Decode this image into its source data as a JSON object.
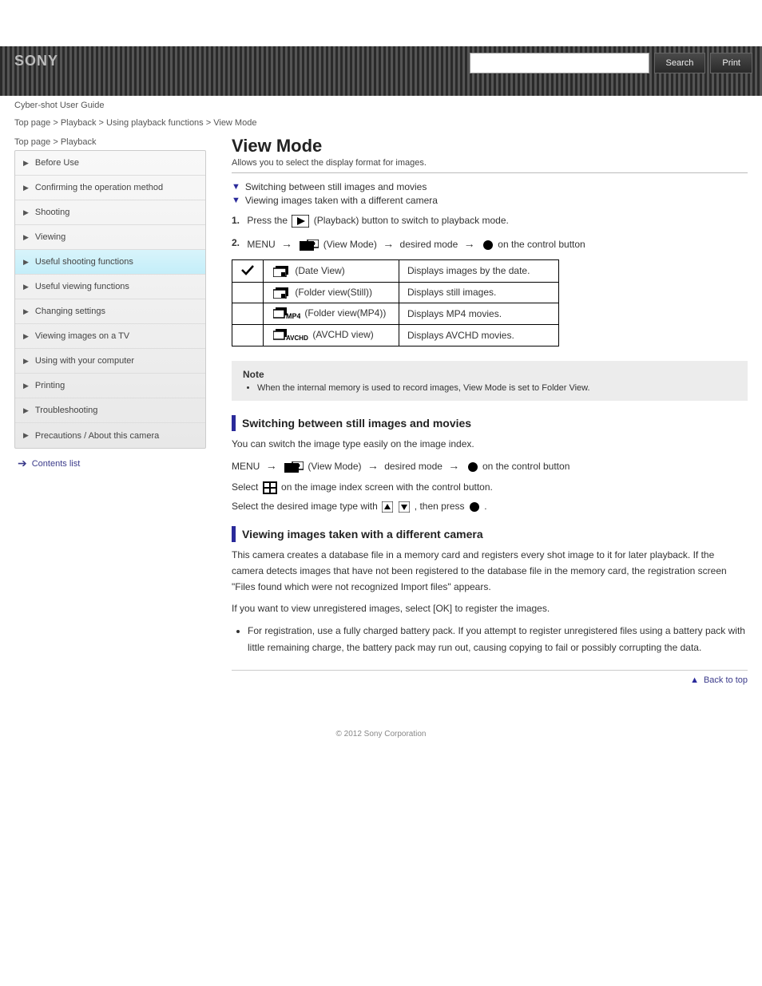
{
  "brand": "SONY",
  "header_links": [
    "Cyber-shot User Guide"
  ],
  "search": {
    "placeholder": "",
    "btn_search": "Search",
    "btn_print": "Print"
  },
  "breadcrumb_top": [
    "Top page",
    "Playback",
    "Using playback functions",
    "View Mode"
  ],
  "breadcrumb_side": [
    "Top page",
    "Playback"
  ],
  "sidebar": {
    "items": [
      "Before Use",
      "Confirming the operation method",
      "Shooting",
      "Viewing",
      "Useful shooting functions",
      "Useful viewing functions",
      "Changing settings",
      "Viewing images on a TV",
      "Using with your computer",
      "Printing",
      "Troubleshooting",
      "Precautions / About this camera"
    ],
    "toppage": "Contents list"
  },
  "page": {
    "title": "View Mode",
    "subtitle": "Allows you to select the display format for images.",
    "items": [
      {
        "label": "Switching between still images and movies"
      },
      {
        "label": "Viewing images taken with a different camera"
      }
    ],
    "step1a": {
      "num": "1.",
      "text_a": "Press the ",
      "text_b": " (Playback) button to switch to playback mode."
    },
    "step2a": {
      "num": "2.",
      "menu": "MENU",
      "lbl1": " (View Mode)",
      "mode": " desired mode",
      "onctl": " on the control button"
    },
    "table": {
      "rows": [
        {
          "chk": true,
          "label": " (Date View)",
          "desc": "Displays images by the date."
        },
        {
          "chk": false,
          "label": " (Folder view(Still))",
          "desc": "Displays still images."
        },
        {
          "chk": false,
          "label": " (Folder view(MP4))",
          "desc": "Displays MP4 movies."
        },
        {
          "chk": false,
          "label": " (AVCHD view)",
          "desc": "Displays AVCHD movies."
        }
      ]
    },
    "note": {
      "title": "Note",
      "body": "When the internal memory is used to record images, View Mode is set to Folder View."
    },
    "sect1": {
      "title": "Switching between still images and movies",
      "intro": "You can switch the image type easily on the image index.",
      "line1a": "Select ",
      "line1b": " on the image index screen with the control button.",
      "line2a": "Select the desired image type with ",
      "line2b": ", then press ",
      "line2c": "."
    },
    "sect2": {
      "title": "Viewing images taken with a different camera",
      "p1": "This camera creates a database file in a memory card and registers every shot image to it for later playback. If the camera detects images that have not been registered to the database file in the memory card, the registration screen \"Files found which were not recognized Import files\" appears.",
      "p2": "If you want to view unregistered images, select [OK] to register the images.",
      "li": "For registration, use a fully charged battery pack. If you attempt to register unregistered files using a battery pack with little remaining charge, the battery pack may run out, causing copying to fail or possibly corrupting the data."
    },
    "backtop": "Back to top"
  },
  "footer": "© 2012 Sony Corporation"
}
